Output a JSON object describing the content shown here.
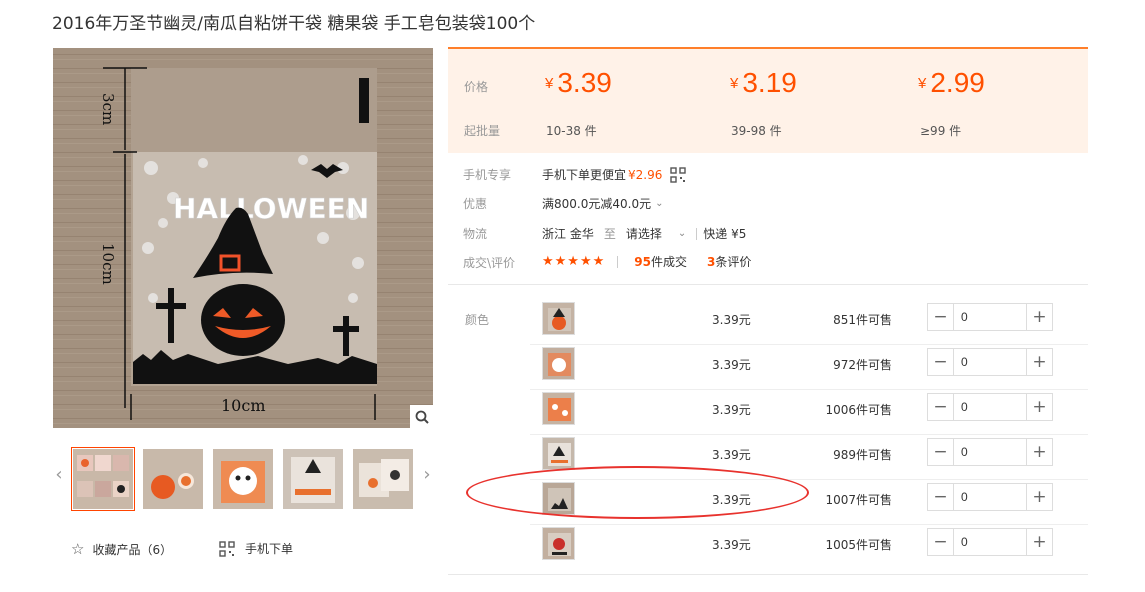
{
  "product": {
    "title": "2016年万圣节幽灵/南瓜自粘饼干袋 糖果袋 手工皂包装袋100个"
  },
  "gallery": {
    "main_image_text": "HALLOWEEN",
    "dims": {
      "top_cm": "3cm",
      "side_cm": "10cm",
      "bottom_cm": "10cm"
    }
  },
  "actions": {
    "favorite_label": "收藏产品（6）",
    "mobile_order_label": "手机下单"
  },
  "price_box": {
    "price_label": "价格",
    "batch_label": "起批量",
    "currency": "¥",
    "tiers": [
      {
        "price": "3.39",
        "batch": "10-38 件"
      },
      {
        "price": "3.19",
        "batch": "39-98 件"
      },
      {
        "price": "2.99",
        "batch": "≥99 件"
      }
    ]
  },
  "info": {
    "mobile_label": "手机专享",
    "mobile_text": "手机下单更便宜",
    "mobile_price": "¥2.96",
    "discount_label": "优惠",
    "discount_text": "满800.0元减40.0元",
    "shipping_label": "物流",
    "shipping_from": "浙江 金华",
    "shipping_to_word": "至",
    "shipping_select": "请选择",
    "shipping_express": "快递 ¥5",
    "deal_label": "成交\\评价",
    "stars": "★★★★★",
    "deals_count": "95",
    "deals_suffix": "件成交",
    "reviews_count": "3",
    "reviews_suffix": "条评价"
  },
  "sku": {
    "color_label": "颜色",
    "rows": [
      {
        "price": "3.39元",
        "stock": "851件可售",
        "qty": "0"
      },
      {
        "price": "3.39元",
        "stock": "972件可售",
        "qty": "0"
      },
      {
        "price": "3.39元",
        "stock": "1006件可售",
        "qty": "0"
      },
      {
        "price": "3.39元",
        "stock": "989件可售",
        "qty": "0"
      },
      {
        "price": "3.39元",
        "stock": "1007件可售",
        "qty": "0"
      },
      {
        "price": "3.39元",
        "stock": "1005件可售",
        "qty": "0"
      }
    ],
    "minus": "−",
    "plus": "+"
  },
  "colors": {
    "accent": "#ff5000",
    "price_bg": "#fff2e8",
    "annotation": "#e8322d"
  }
}
